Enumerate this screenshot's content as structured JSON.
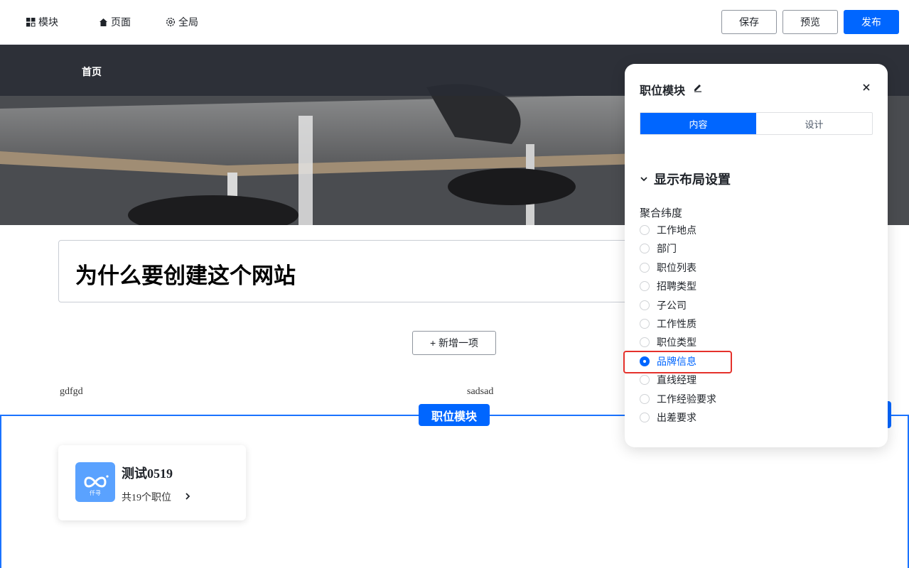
{
  "toolbar": {
    "nav": [
      {
        "label": "模块",
        "icon": "modules-icon"
      },
      {
        "label": "页面",
        "icon": "home-icon"
      },
      {
        "label": "全局",
        "icon": "gear-icon"
      }
    ],
    "save_label": "保存",
    "preview_label": "预览",
    "publish_label": "发布"
  },
  "hero": {
    "nav_link": "首页"
  },
  "content": {
    "title": "为什么要创建这个网站",
    "add_item_label": "+ 新增一项",
    "text_left": "gdfgd",
    "text_middle": "sadsad"
  },
  "module": {
    "tag_label": "职位模块",
    "card": {
      "logo_text": "仟寻",
      "company": "测试0519",
      "jobs_count": "共19个职位"
    }
  },
  "panel": {
    "title": "职位模块",
    "tabs": [
      {
        "label": "内容",
        "active": true
      },
      {
        "label": "设计",
        "active": false
      }
    ],
    "section_title": "显示布局设置",
    "group_label": "聚合纬度",
    "options": [
      {
        "label": "工作地点",
        "checked": false
      },
      {
        "label": "部门",
        "checked": false
      },
      {
        "label": "职位列表",
        "checked": false
      },
      {
        "label": "招聘类型",
        "checked": false
      },
      {
        "label": "子公司",
        "checked": false
      },
      {
        "label": "工作性质",
        "checked": false
      },
      {
        "label": "职位类型",
        "checked": false
      },
      {
        "label": "品牌信息",
        "checked": true
      },
      {
        "label": "直线经理",
        "checked": false
      },
      {
        "label": "工作经验要求",
        "checked": false
      },
      {
        "label": "出差要求",
        "checked": false
      }
    ]
  },
  "colors": {
    "primary": "#0066ff",
    "highlight": "#e5312b",
    "frame": "#1a73ff"
  }
}
